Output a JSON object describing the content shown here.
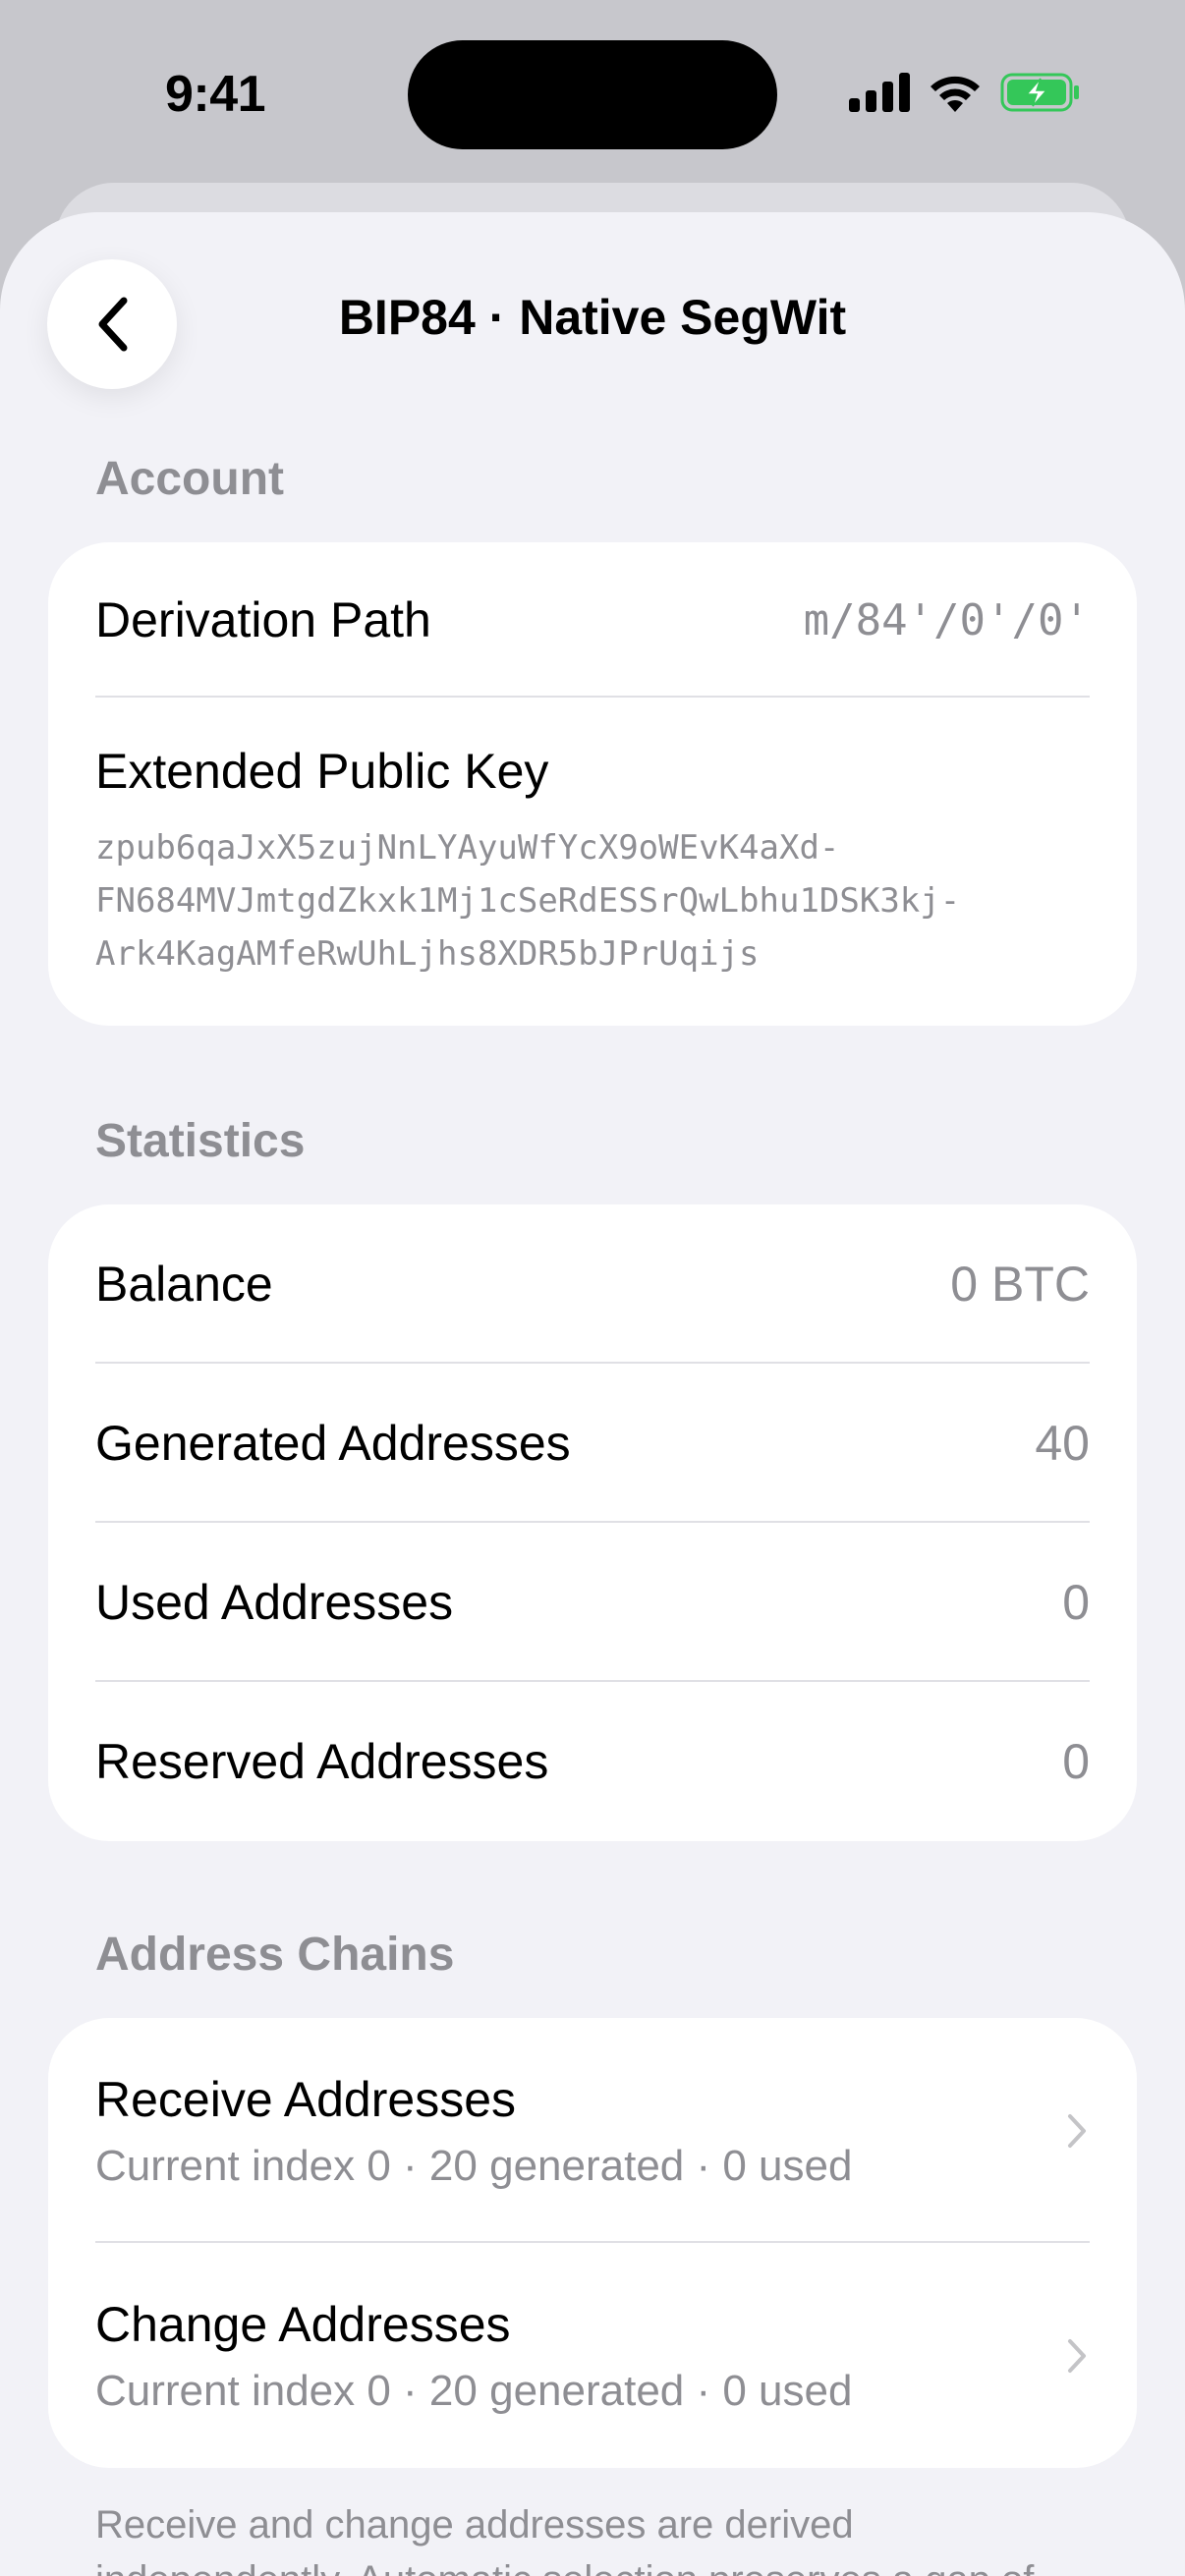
{
  "status": {
    "time": "9:41"
  },
  "nav": {
    "title": "BIP84 · Native SegWit"
  },
  "account": {
    "header": "Account",
    "derivation_label": "Derivation Path",
    "derivation_value": "m/84'/0'/0'",
    "xpub_label": "Extended Public Key",
    "xpub_lines": [
      "zpub6qaJxX5zujNnLYAyuWfYcX9oWEvK4aXd-",
      "FN684MVJmtgdZkxk1Mj1cSeRdESSrQwLbhu1DSK3kj-",
      "Ark4KagAMfeRwUhLjhs8XDR5bJPrUqijs"
    ]
  },
  "statistics": {
    "header": "Statistics",
    "rows": [
      {
        "label": "Balance",
        "value": "0 BTC"
      },
      {
        "label": "Generated Addresses",
        "value": "40"
      },
      {
        "label": "Used Addresses",
        "value": "0"
      },
      {
        "label": "Reserved Addresses",
        "value": "0"
      }
    ]
  },
  "chains": {
    "header": "Address Chains",
    "items": [
      {
        "title": "Receive Addresses",
        "subtitle": "Current index 0 · 20 generated · 0 used"
      },
      {
        "title": "Change Addresses",
        "subtitle": "Current index 0 · 20 generated · 0 used"
      }
    ]
  },
  "footer": {
    "note": "Receive and change addresses are derived independently. Automatic selection preserves a gap of"
  },
  "colors": {
    "background": "#f2f2f7",
    "card": "#ffffff",
    "secondary_text": "#8e8e93",
    "battery_green": "#34c759"
  }
}
